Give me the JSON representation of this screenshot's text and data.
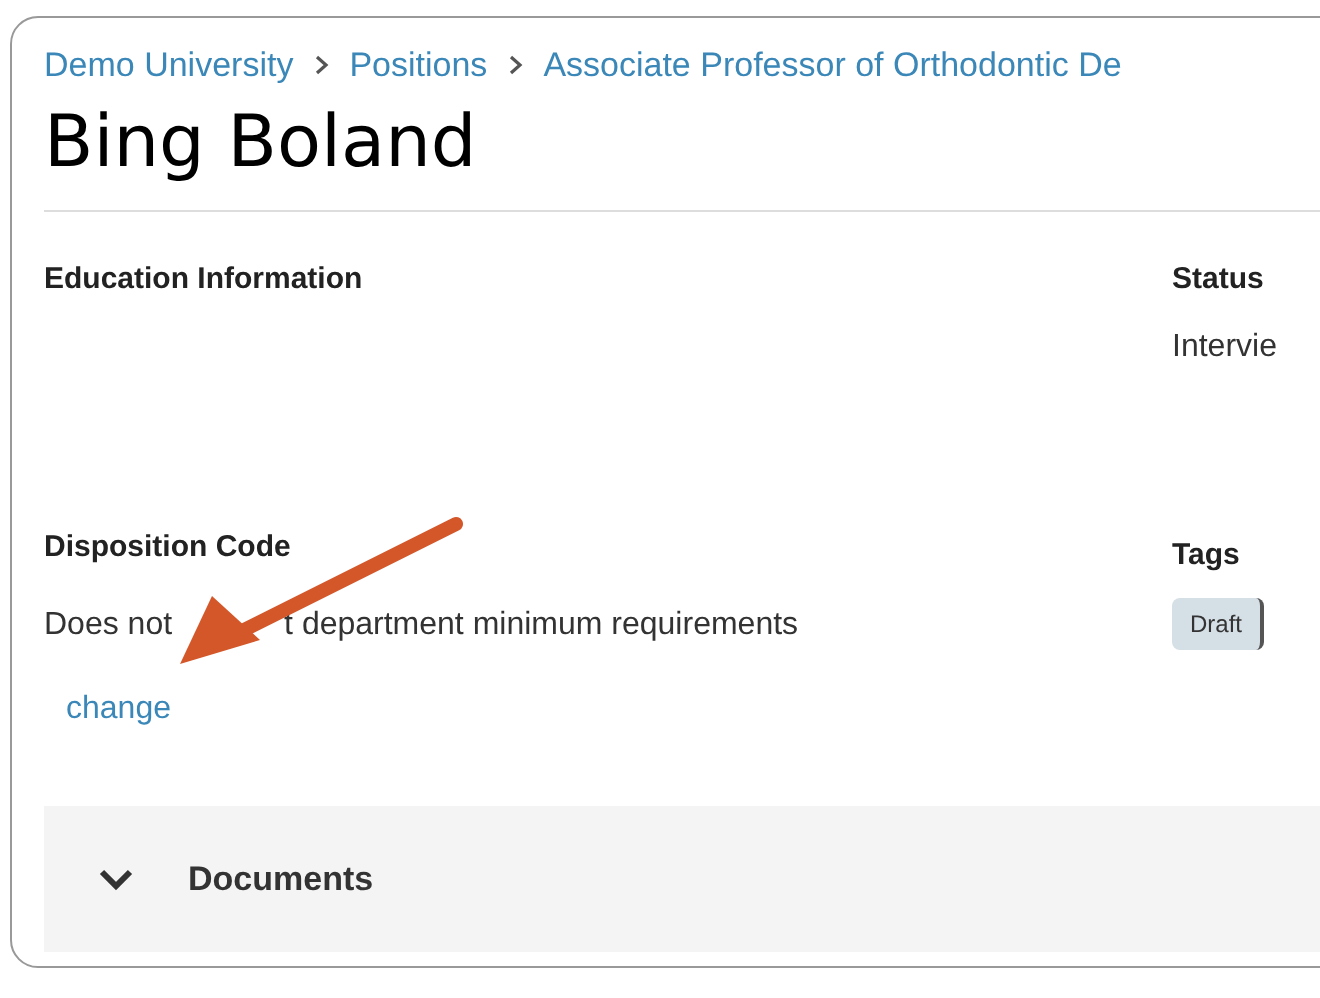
{
  "breadcrumbs": [
    "Demo University",
    "Positions",
    "Associate Professor of Orthodontic De"
  ],
  "title": "Bing Boland",
  "education": {
    "label": "Education Information"
  },
  "status": {
    "label": "Status",
    "value": "Intervie"
  },
  "disposition": {
    "label": "Disposition Code",
    "value_parts": [
      "Does not",
      "t department minimum requirements"
    ],
    "link": "change"
  },
  "tags": {
    "label": "Tags",
    "items": [
      "Draft"
    ]
  },
  "sections": [
    {
      "label": "Documents",
      "expanded": true
    }
  ]
}
